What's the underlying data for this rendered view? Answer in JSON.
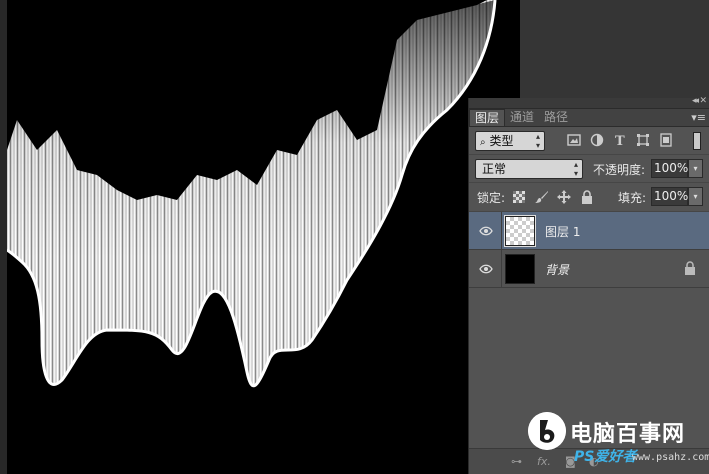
{
  "layers_panel": {
    "tabs": [
      {
        "label": "图层",
        "active": true
      },
      {
        "label": "通道",
        "active": false
      },
      {
        "label": "路径",
        "active": false
      }
    ],
    "filter_kind_label": "类型",
    "blend_mode": "正常",
    "opacity_label": "不透明度:",
    "opacity_value": "100%",
    "lock_label": "锁定:",
    "fill_label": "填充:",
    "fill_value": "100%",
    "layers": [
      {
        "name": "图层 1",
        "selected": true,
        "thumbnail": "transparent",
        "visible": true,
        "locked": false
      },
      {
        "name": "背景",
        "selected": false,
        "thumbnail": "black",
        "visible": true,
        "locked": true
      }
    ],
    "bottom_icons": [
      "link-icon",
      "fx-icon",
      "mask-icon",
      "adjustment-icon",
      "group-icon",
      "new-layer-icon",
      "trash-icon"
    ],
    "bottom_fx_label": "fx."
  },
  "watermark": {
    "title": "电脑百事网",
    "sub": "PS爱好者",
    "url": "www.psahz.com"
  },
  "colors": {
    "panel_bg": "#535353",
    "selected_layer": "#5a6a80",
    "canvas_bg": "#000000",
    "workspace_bg": "#282828"
  }
}
